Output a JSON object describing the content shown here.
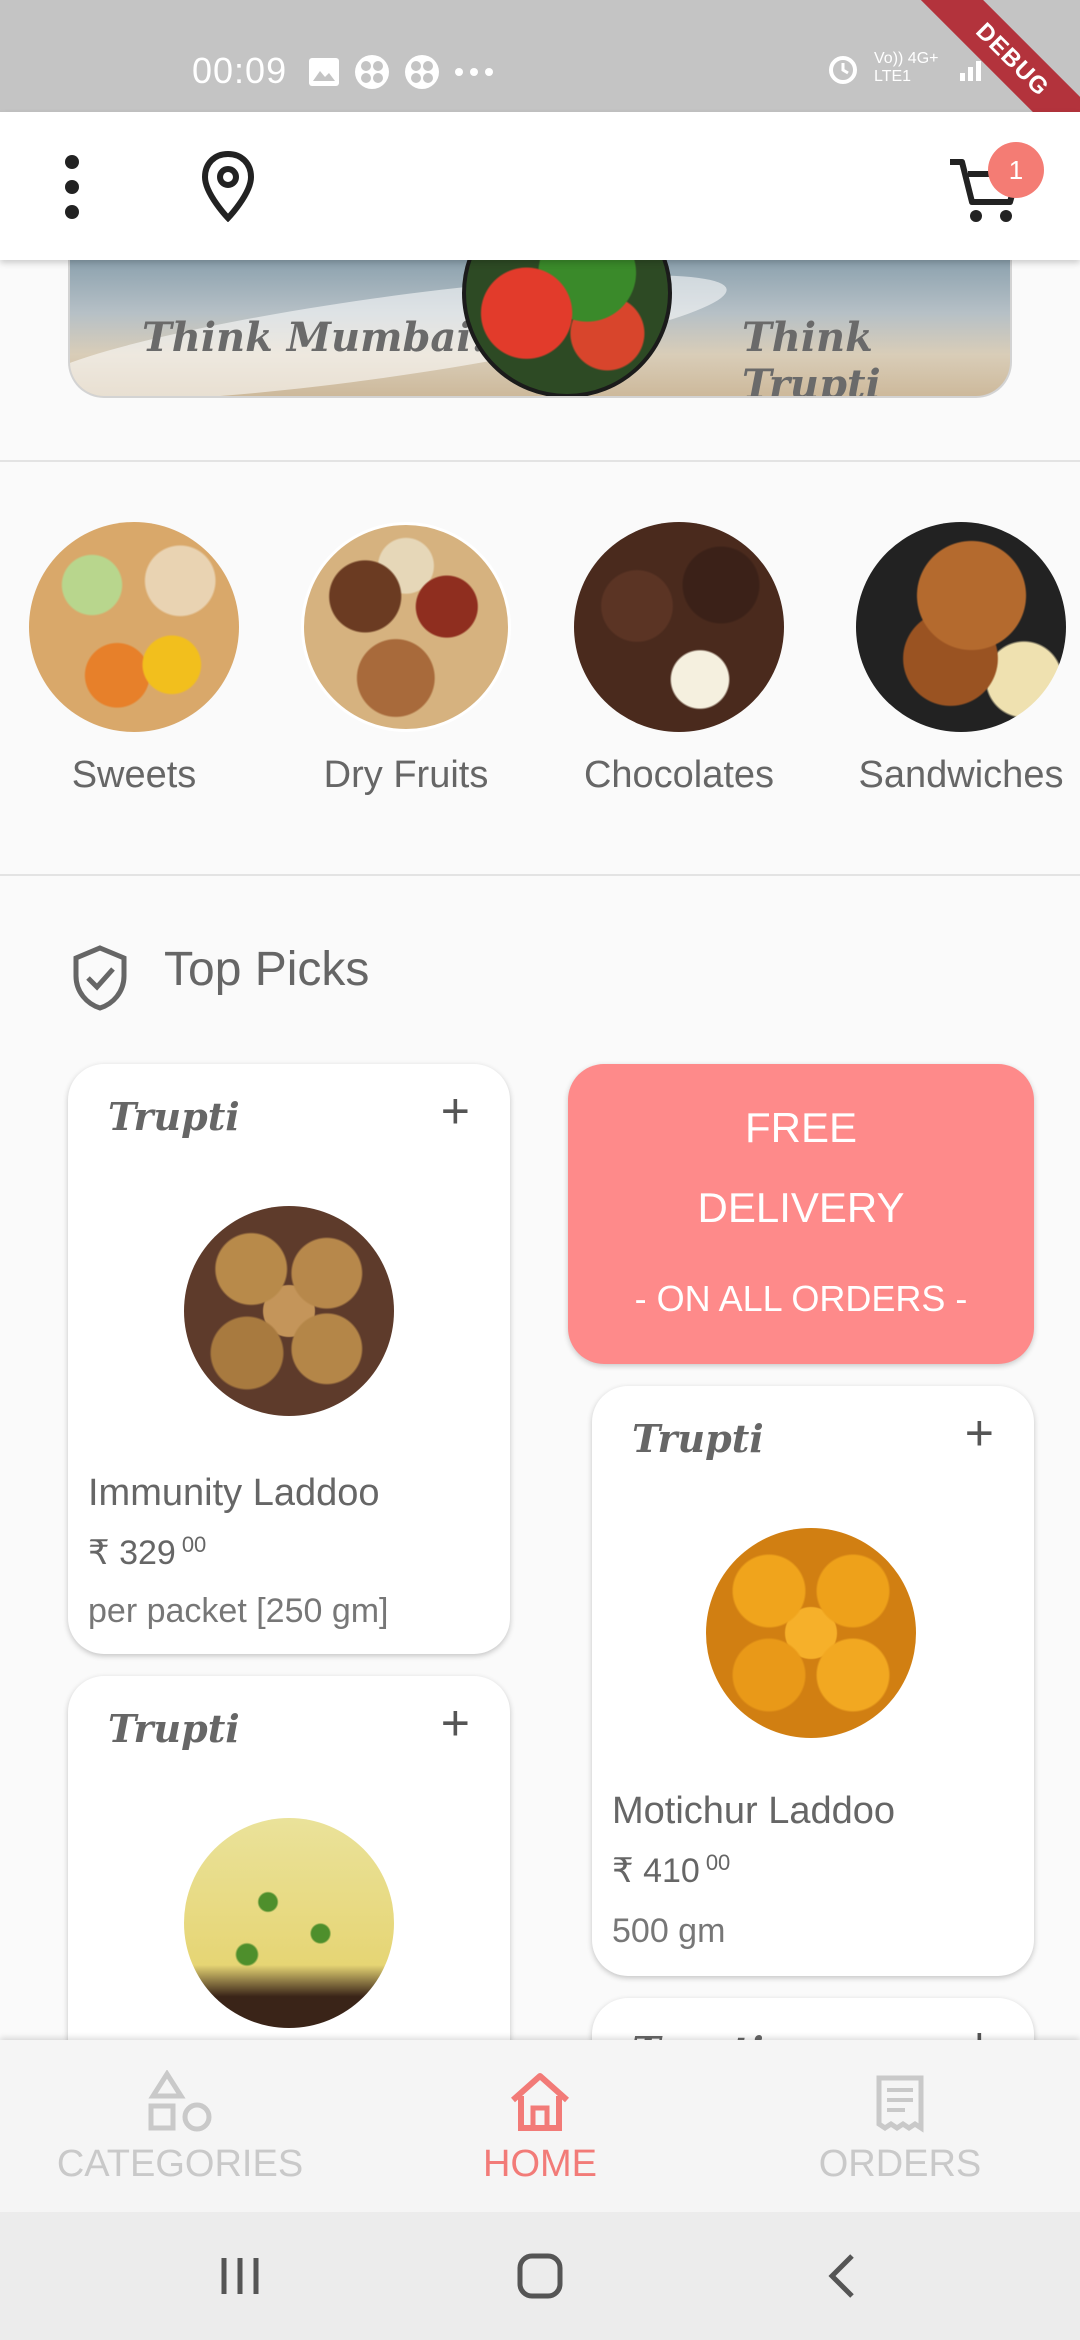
{
  "status_bar": {
    "time": "00:09",
    "network_label": "Vo)) 4G+ LTE1",
    "debug_label": "DEBUG"
  },
  "app_bar": {
    "cart_count": "1"
  },
  "banner": {
    "left_text": "Think Mumbai.",
    "right_text": "Think Trupti"
  },
  "categories": [
    {
      "label": "Sweets",
      "icon": "sweets-image"
    },
    {
      "label": "Dry Fruits",
      "icon": "dry-fruits-image"
    },
    {
      "label": "Chocolates",
      "icon": "chocolates-image"
    },
    {
      "label": "Sandwiches",
      "icon": "sandwiches-image"
    }
  ],
  "top_picks": {
    "title": "Top Picks",
    "promo": {
      "line1": "FREE",
      "line2": "DELIVERY",
      "line3": "- ON ALL ORDERS -"
    },
    "products": [
      {
        "brand": "Trupti",
        "name": "Immunity Laddoo",
        "price_main": "₹ 329",
        "price_decimal": "00",
        "unit": "per packet [250 gm]"
      },
      {
        "brand": "Trupti",
        "name": "Motichur Laddoo",
        "price_main": "₹ 410",
        "price_decimal": "00",
        "unit": "500 gm"
      },
      {
        "brand": "Trupti"
      },
      {
        "brand": "Trupti"
      }
    ],
    "add_label": "+"
  },
  "bottom_nav": {
    "items": [
      {
        "label": "CATEGORIES",
        "icon": "categories-icon",
        "active": false
      },
      {
        "label": "HOME",
        "icon": "home-icon",
        "active": true
      },
      {
        "label": "ORDERS",
        "icon": "orders-icon",
        "active": false
      }
    ]
  },
  "colors": {
    "accent": "#f27b78",
    "promo_bg": "#fe8a8a",
    "badge": "#f47c74",
    "status_bar": "#c4c4c4"
  }
}
